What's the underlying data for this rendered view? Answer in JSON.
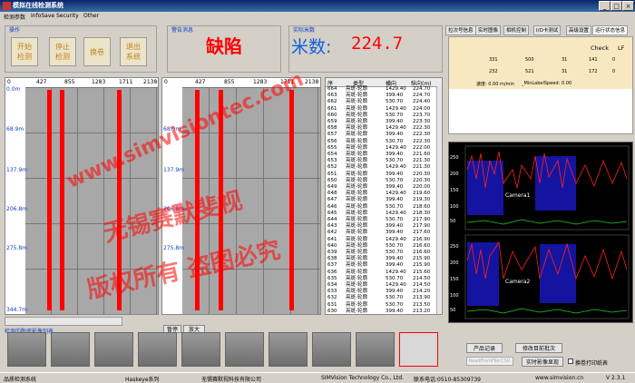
{
  "window": {
    "title": "模拟在线检测系统",
    "min": "_",
    "max": "□",
    "close": "×"
  },
  "menu": [
    "检测参数",
    "InfoSave",
    "Security",
    "Other"
  ],
  "operations": {
    "label": "操作",
    "buttons": [
      {
        "line1": "开始",
        "line2": "检测"
      },
      {
        "line1": "停止",
        "line2": "检测"
      },
      {
        "line1": "换卷",
        "line2": ""
      },
      {
        "line1": "退出",
        "line2": "系统"
      }
    ]
  },
  "alarm": {
    "label": "警告消息",
    "text": "缺陷"
  },
  "meter": {
    "label": "实际米数",
    "prefix": "米数:",
    "value": "224.7"
  },
  "plots": {
    "x_ticks": [
      "0",
      "427",
      "855",
      "1283",
      "1711",
      "2138"
    ],
    "x_unit": "mm",
    "y_ticks": [
      "0.0m",
      "68.9m",
      "137.9m",
      "206.8m",
      "275.8m",
      "344.7m"
    ]
  },
  "defect_table": {
    "headers": [
      "序",
      "类型",
      "横向",
      "纵向(m)"
    ],
    "rows": [
      [
        "664",
        "亮斑-轮廓",
        "1429.40",
        "224.70"
      ],
      [
        "663",
        "亮斑-轮廓",
        "399.40",
        "224.70"
      ],
      [
        "662",
        "亮斑-轮廓",
        "530.70",
        "224.40"
      ],
      [
        "661",
        "亮斑-轮廓",
        "1429.40",
        "224.00"
      ],
      [
        "660",
        "亮斑-轮廓",
        "530.70",
        "223.70"
      ],
      [
        "659",
        "亮斑-轮廓",
        "399.40",
        "223.30"
      ],
      [
        "658",
        "亮斑-轮廓",
        "1429.40",
        "222.30"
      ],
      [
        "657",
        "亮斑-轮廓",
        "399.40",
        "222.30"
      ],
      [
        "656",
        "亮斑-轮廓",
        "530.70",
        "222.30"
      ],
      [
        "655",
        "亮斑-轮廓",
        "1429.40",
        "222.00"
      ],
      [
        "654",
        "亮斑-轮廓",
        "399.40",
        "221.60"
      ],
      [
        "653",
        "亮斑-轮廓",
        "530.70",
        "221.30"
      ],
      [
        "652",
        "亮斑-轮廓",
        "1429.40",
        "221.30"
      ],
      [
        "651",
        "亮斑-轮廓",
        "399.40",
        "220.30"
      ],
      [
        "650",
        "亮斑-轮廓",
        "530.70",
        "220.30"
      ],
      [
        "649",
        "亮斑-轮廓",
        "399.40",
        "220.00"
      ],
      [
        "648",
        "亮斑-轮廓",
        "1429.40",
        "219.60"
      ],
      [
        "647",
        "亮斑-轮廓",
        "399.40",
        "219.30"
      ],
      [
        "646",
        "亮斑-轮廓",
        "530.70",
        "218.60"
      ],
      [
        "645",
        "亮斑-轮廓",
        "1429.40",
        "218.30"
      ],
      [
        "644",
        "亮斑-轮廓",
        "530.70",
        "217.90"
      ],
      [
        "643",
        "亮斑-轮廓",
        "399.40",
        "217.90"
      ],
      [
        "642",
        "亮斑-轮廓",
        "399.40",
        "217.60"
      ],
      [
        "641",
        "亮斑-轮廓",
        "1429.40",
        "216.90"
      ],
      [
        "640",
        "亮斑-轮廓",
        "530.70",
        "216.60"
      ],
      [
        "639",
        "亮斑-轮廓",
        "530.70",
        "216.60"
      ],
      [
        "638",
        "亮斑-轮廓",
        "399.40",
        "215.90"
      ],
      [
        "637",
        "亮斑-轮廓",
        "399.40",
        "215.90"
      ],
      [
        "636",
        "亮斑-轮廓",
        "1429.40",
        "215.60"
      ],
      [
        "635",
        "亮斑-轮廓",
        "530.70",
        "214.50"
      ],
      [
        "634",
        "亮斑-轮廓",
        "1429.40",
        "214.50"
      ],
      [
        "633",
        "亮斑-轮廓",
        "399.40",
        "214.20"
      ],
      [
        "632",
        "亮斑-轮廓",
        "530.70",
        "213.90"
      ],
      [
        "631",
        "亮斑-轮廓",
        "530.70",
        "213.50"
      ],
      [
        "630",
        "亮斑-轮廓",
        "399.40",
        "213.20"
      ]
    ]
  },
  "tabs": [
    "拉次号信息",
    "实时图像",
    "相机控制",
    "I/O卡测试",
    "高级设置",
    "运行状态信息"
  ],
  "status_panel": {
    "check_header": "Check",
    "lf_header": "LF",
    "row1": [
      "331",
      "500",
      "31",
      "141",
      "0"
    ],
    "row2": [
      "232",
      "521",
      "31",
      "172",
      "0"
    ],
    "speed_label": "速度: 0.00 m/min",
    "speed_name": "_MinLabelSpeed:",
    "speed_val": "0.00"
  },
  "camera_plots": {
    "cam1": "Camera1",
    "cam2": "Camera2",
    "y_ticks_top": [
      "250",
      "200",
      "150",
      "100",
      "50"
    ],
    "y_ticks_bottom": [
      "250",
      "200",
      "150",
      "100",
      "50"
    ]
  },
  "bottom_buttons": {
    "record": "产品记录",
    "modify": "修改目前批次",
    "realtime": "实时影像显现",
    "print_label": "换卷打印纸表",
    "readonly_box": "ReadFromFile-CSV"
  },
  "scroll_controls": {
    "b1": "暂停",
    "b2": "放大"
  },
  "thumbs_label": "检测的陶瓷影像列表",
  "statusbar": {
    "app": "品质检测系统",
    "series": "Haskeye系列",
    "company": "无锡赛默视科技有限公司",
    "company_en": "SIMVision Technology Co., Ltd.",
    "phone": "联系电话:0510-85309739",
    "web": "www.simvision.cn",
    "version": "V 2.3.1"
  },
  "watermark": {
    "url": "www.simvisiontec.com",
    "name": "无锡赛默斐视",
    "rights": "版权所有  盗图必究"
  },
  "colors": {
    "alarm": "#ff0000",
    "meter": "#1060e0",
    "defect": "#ff0000"
  }
}
